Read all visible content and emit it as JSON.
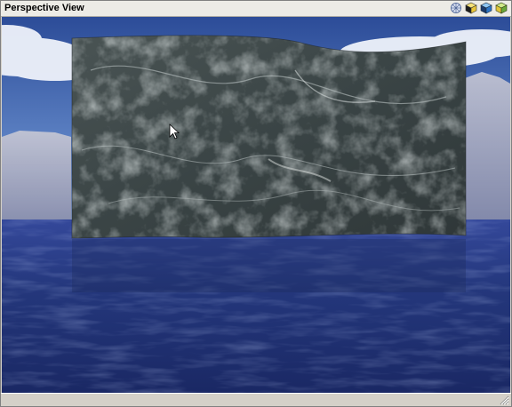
{
  "window": {
    "title": "Perspective View"
  },
  "toolbar": {
    "icons": [
      "view-settings-icon",
      "shaded-cube-icon",
      "blue-cube-icon",
      "green-cube-icon"
    ]
  },
  "colors": {
    "sky_top": "#2f4f9a",
    "sky_mid": "#6b8fcf",
    "water_top": "#2c3f86",
    "water_bottom": "#1b2a66",
    "mountain": "#a9aec3",
    "terrain_dark": "#3b4547",
    "terrain_light": "#8f9a98"
  }
}
